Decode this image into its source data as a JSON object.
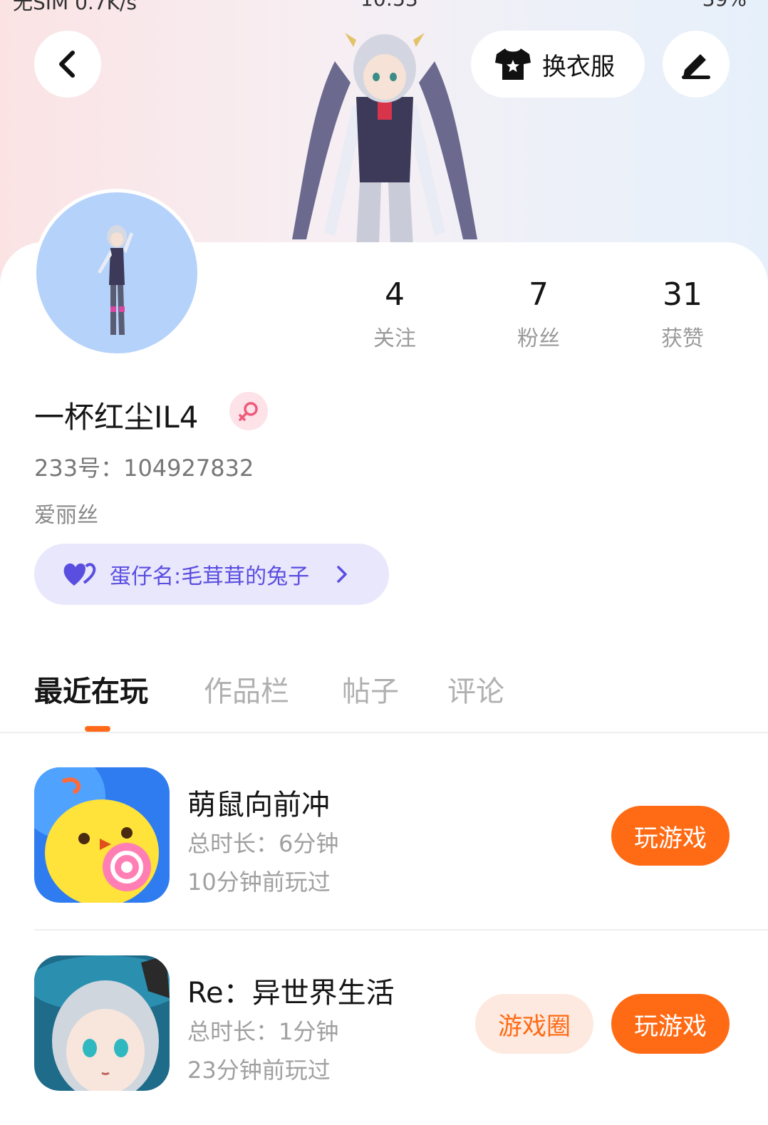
{
  "status_bar": {
    "left": "无SIM 0.7K/s",
    "time": "10:53",
    "right": "39%"
  },
  "header": {
    "outfit_label": "换衣服"
  },
  "stats": [
    {
      "value": "4",
      "label": "关注"
    },
    {
      "value": "7",
      "label": "粉丝"
    },
    {
      "value": "31",
      "label": "获赞"
    }
  ],
  "profile": {
    "username": "一杯红尘IL4",
    "uid": "233号：104927832",
    "signature": "爱丽丝",
    "egg_name": "蛋仔名:毛茸茸的兔子"
  },
  "tabs": [
    {
      "label": "最近在玩",
      "active": true
    },
    {
      "label": "作品栏",
      "active": false
    },
    {
      "label": "帖子",
      "active": false
    },
    {
      "label": "评论",
      "active": false
    }
  ],
  "games": [
    {
      "name": "萌鼠向前冲",
      "duration": "总时长：6分钟",
      "last_played": "10分钟前玩过",
      "play_label": "玩游戏"
    },
    {
      "name": "Re：异世界生活",
      "duration": "总时长：1分钟",
      "last_played": "23分钟前玩过",
      "circle_label": "游戏圈",
      "play_label": "玩游戏"
    }
  ],
  "colors": {
    "accent": "#ff6a14",
    "egg_pill_bg": "#e9e7fb",
    "egg_pill_text": "#5a4ee0",
    "avatar_bg": "#b5d2fb"
  }
}
